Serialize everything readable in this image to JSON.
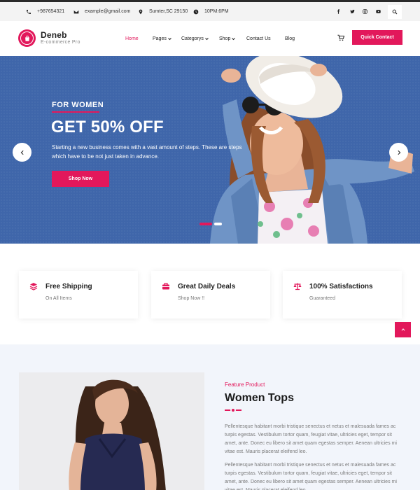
{
  "topbar": {
    "phone": "+987654321",
    "email": "example@gmail.com",
    "address": "Sumter,SC 29150",
    "hours": "10PM:6PM",
    "social": [
      "facebook-icon",
      "twitter-icon",
      "instagram-icon",
      "youtube-icon"
    ]
  },
  "header": {
    "brand_name": "Deneb",
    "brand_tagline": "E-commerce Pro",
    "nav": [
      {
        "label": "Home",
        "active": true
      },
      {
        "label": "Pages"
      },
      {
        "label": "Categorys"
      },
      {
        "label": "Shop"
      },
      {
        "label": "Contact Us"
      },
      {
        "label": "Blog"
      }
    ],
    "quick_contact": "Quick Contact"
  },
  "hero": {
    "eyebrow": "FOR WOMEN",
    "title": "GET 50% OFF",
    "text": "Starting a new business comes with a vast amount of steps. These are steps which have to be not just taken in advance.",
    "button": "Shop Now",
    "active_slide": 1,
    "slides": 2
  },
  "features": [
    {
      "title": "Free Shipping",
      "subtitle": "On All Items",
      "icon": "layers-icon"
    },
    {
      "title": "Great Daily Deals",
      "subtitle": "Shop Now !!",
      "icon": "briefcase-icon"
    },
    {
      "title": "100% Satisfactions",
      "subtitle": "Guaranteed",
      "icon": "balance-scale-icon"
    }
  ],
  "product": {
    "label": "Feature Product",
    "title": "Women Tops",
    "para1": "Pellentesque habitant morbi tristique senectus et netus et malesuada fames ac turpis egestas. Vestibulum tortor quam, feugiat vitae, ultricies eget, tempor sit amet, ante. Donec eu libero sit amet quam egestas semper. Aenean ultricies mi vitae est. Mauris placerat eleifend leo.",
    "para2": "Pellentesque habitant morbi tristique senectus et netus et malesuada fames ac turpis egestas. Vestibulum tortor quam, feugiat vitae, ultricies eget, tempor sit amet, ante. Donec eu libero sit amet quam egestas semper. Aenean ultricies mi vitae est. Mauris placerat eleifend leo."
  },
  "colors": {
    "accent": "#e2185b",
    "hero_bg": "#3f66aa"
  }
}
